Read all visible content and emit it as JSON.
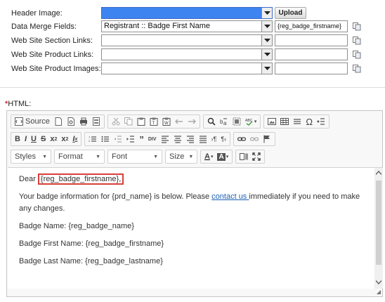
{
  "form": {
    "rows": [
      {
        "label": "Header Image:",
        "value": "",
        "side_kind": "button",
        "side": "Upload"
      },
      {
        "label": "Data Merge Fields:",
        "value": "Registrant :: Badge First Name",
        "side_kind": "text",
        "side": "{reg_badge_firstname}"
      },
      {
        "label": "Web Site Section Links:",
        "value": "",
        "side_kind": "text",
        "side": ""
      },
      {
        "label": "Web Site Product Links:",
        "value": "",
        "side_kind": "text",
        "side": ""
      },
      {
        "label": "Web Site Product Images:",
        "value": "",
        "side_kind": "text",
        "side": ""
      }
    ]
  },
  "html_section": {
    "required_star": "*",
    "label": "HTML:"
  },
  "toolbar": {
    "source_label": "Source",
    "styles_label": "Styles",
    "format_label": "Format",
    "font_label": "Font",
    "size_label": "Size",
    "bold": "B",
    "italic": "I",
    "underline": "U",
    "strike": "S"
  },
  "content": {
    "p1_prefix": "Dear ",
    "p1_field": "{reg_badge_firstname},",
    "p2_before": "Your badge information for {prd_name} is below. Please ",
    "p2_link": "contact us ",
    "p2_after": "immediately if you need to make any changes.",
    "p3": "Badge Name: {reg_badge_name}",
    "p4": "Badge First Name: {reg_badge_firstname}",
    "p5": "Badge Last Name: {reg_badge_lastname}"
  },
  "colors": {
    "selection": "#3d84f1",
    "highlight_border": "#d9403a",
    "link": "#1b5fb3"
  }
}
